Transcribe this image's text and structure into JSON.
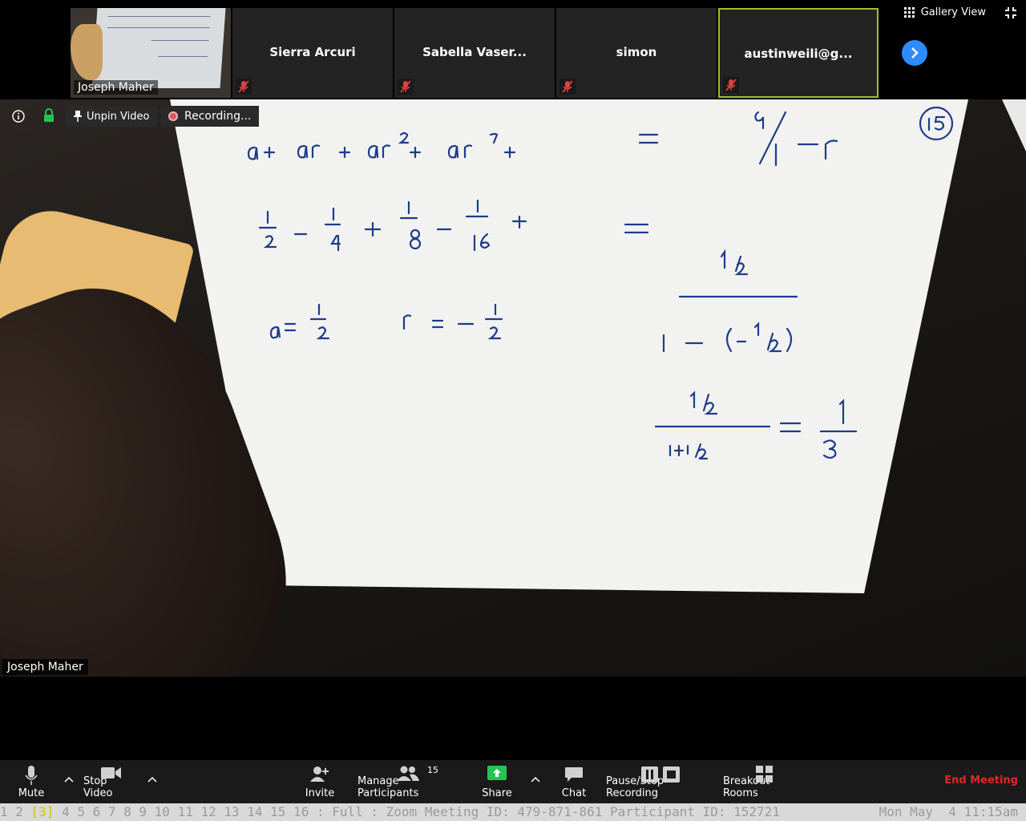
{
  "filmstrip": {
    "thumbnail_name": "Joseph Maher",
    "participants": [
      {
        "name": "Sierra Arcuri"
      },
      {
        "name": "Sabella Vaser..."
      },
      {
        "name": "simon"
      },
      {
        "name": "austinweili@g..."
      }
    ],
    "gallery_view_label": "Gallery View"
  },
  "video_toolbar": {
    "unpin_label": "Unpin Video",
    "recording_label": "Recording..."
  },
  "main_video": {
    "speaker_name": "Joseph Maher"
  },
  "toolbar": {
    "mute_label": "Mute",
    "stop_video_label": "Stop Video",
    "invite_label": "Invite",
    "manage_participants_label": "Manage Participants",
    "participant_count": "15",
    "share_label": "Share",
    "chat_label": "Chat",
    "recording_label": "Pause/Stop Recording",
    "breakout_label": "Breakout Rooms",
    "end_label": "End Meeting"
  },
  "colors": {
    "accent_blue": "#2d8cff",
    "active_border": "#9bc02c",
    "end_red": "#e02828",
    "share_green": "#23c552"
  },
  "statusbar": {
    "before": "1 2 ",
    "current": "[3]",
    "after": " 4 5 6 7 8 9 10 11 12 13 14 15 16 : Full : Zoom Meeting ID: 479-871-861 Participant ID: 152721",
    "clock": "Mon May  4 11:15am"
  }
}
